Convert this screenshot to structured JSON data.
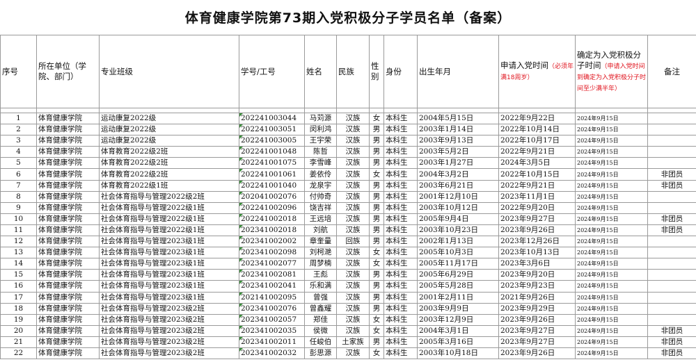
{
  "title": "体育健康学院第73期入党积极分子学员名单（备案）",
  "headers": {
    "seq": "序号",
    "unit": "所在单位（学院、部门）",
    "class": "专业班级",
    "id": "学号/工号",
    "name": "姓名",
    "ethnicity": "民族",
    "gender": "性别",
    "identity": "身份",
    "birth": "出生年月",
    "apply": "申请入党时间",
    "apply_note": "（必须年满18周岁）",
    "confirm": "确定为入党积极分子时间",
    "confirm_note": "（申请入党时间到确定为入党积极分子时间至少满半年）",
    "remark": "备注"
  },
  "rows": [
    {
      "seq": "1",
      "unit": "体育健康学院",
      "class": "运动康复2022级",
      "id": "202241003044",
      "name": "马苅源",
      "ethnicity": "汉族",
      "gender": "女",
      "identity": "本科生",
      "birth": "2004年5月15日",
      "apply": "2022年9月22日",
      "confirm": "2024年9月15日",
      "remark": ""
    },
    {
      "seq": "2",
      "unit": "体育健康学院",
      "class": "运动康复2022级",
      "id": "202241003051",
      "name": "闵利鸿",
      "ethnicity": "汉族",
      "gender": "男",
      "identity": "本科生",
      "birth": "2003年1月14日",
      "apply": "2022年10月14日",
      "confirm": "2024年9月15日",
      "remark": ""
    },
    {
      "seq": "3",
      "unit": "体育健康学院",
      "class": "运动康复2022级",
      "id": "202241003005",
      "name": "王宇荣",
      "ethnicity": "汉族",
      "gender": "男",
      "identity": "本科生",
      "birth": "2003年9月13日",
      "apply": "2022年10月17日",
      "confirm": "2024年9月15日",
      "remark": ""
    },
    {
      "seq": "4",
      "unit": "体育健康学院",
      "class": "体育教育2022级2班",
      "id": "202241001048",
      "name": "陈哲",
      "ethnicity": "汉族",
      "gender": "男",
      "identity": "本科生",
      "birth": "2003年5月2日",
      "apply": "2022年9月21日",
      "confirm": "2024年9月15日",
      "remark": ""
    },
    {
      "seq": "5",
      "unit": "体育健康学院",
      "class": "体育教育2022级2班",
      "id": "202241001075",
      "name": "李雪峰",
      "ethnicity": "汉族",
      "gender": "男",
      "identity": "本科生",
      "birth": "2003年1月27日",
      "apply": "2024年3月5日",
      "confirm": "2024年9月15日",
      "remark": ""
    },
    {
      "seq": "6",
      "unit": "体育健康学院",
      "class": "体育教育2022级2班",
      "id": "202241001061",
      "name": "姜依伶",
      "ethnicity": "汉族",
      "gender": "女",
      "identity": "本科生",
      "birth": "2004年3月2日",
      "apply": "2022年10月15日",
      "confirm": "2024年9月15日",
      "remark": "非团员"
    },
    {
      "seq": "7",
      "unit": "体育健康学院",
      "class": "体育教育2022级1班",
      "id": "202241001040",
      "name": "龙泉宇",
      "ethnicity": "汉族",
      "gender": "男",
      "identity": "本科生",
      "birth": "2003年6月21日",
      "apply": "2022年9月21日",
      "confirm": "2024年9月15日",
      "remark": "非团员"
    },
    {
      "seq": "8",
      "unit": "体育健康学院",
      "class": "社会体育指导与管理2022级2班",
      "id": "202041002076",
      "name": "付帅奇",
      "ethnicity": "汉族",
      "gender": "男",
      "identity": "本科生",
      "birth": "2001年12月10日",
      "apply": "2023年11月1日",
      "confirm": "2024年9月15日",
      "remark": ""
    },
    {
      "seq": "9",
      "unit": "体育健康学院",
      "class": "社会体育指导与管理2022级1班",
      "id": "202241002096",
      "name": "饶吉祥",
      "ethnicity": "汉族",
      "gender": "男",
      "identity": "本科生",
      "birth": "2003年10月12日",
      "apply": "2022年9月20日",
      "confirm": "2024年9月15日",
      "remark": ""
    },
    {
      "seq": "10",
      "unit": "体育健康学院",
      "class": "社会体育指导与管理2022级1班",
      "id": "202241002018",
      "name": "王远培",
      "ethnicity": "汉族",
      "gender": "男",
      "identity": "本科生",
      "birth": "2005年9月4日",
      "apply": "2023年9月27日",
      "confirm": "2024年9月15日",
      "remark": "非团员"
    },
    {
      "seq": "11",
      "unit": "体育健康学院",
      "class": "社会体育指导与管理2022级1班",
      "id": "202341002018",
      "name": "刘航",
      "ethnicity": "汉族",
      "gender": "男",
      "identity": "本科生",
      "birth": "2003年10月23日",
      "apply": "2023年9月26日",
      "confirm": "2024年9月15日",
      "remark": "非团员"
    },
    {
      "seq": "12",
      "unit": "体育健康学院",
      "class": "社会体育指导与管理2023级1班",
      "id": "202341002002",
      "name": "章奎量",
      "ethnicity": "回族",
      "gender": "男",
      "identity": "本科生",
      "birth": "2002年1月13日",
      "apply": "2023年12月26日",
      "confirm": "2024年9月15日",
      "remark": ""
    },
    {
      "seq": "13",
      "unit": "体育健康学院",
      "class": "社会体育指导与管理2023级1班",
      "id": "202341002098",
      "name": "刘柯滟",
      "ethnicity": "汉族",
      "gender": "女",
      "identity": "本科生",
      "birth": "2005年10月3日",
      "apply": "2023年10月13日",
      "confirm": "2024年9月15日",
      "remark": ""
    },
    {
      "seq": "14",
      "unit": "体育健康学院",
      "class": "社会体育指导与管理2023级1班",
      "id": "202341002077",
      "name": "周梦楠",
      "ethnicity": "汉族",
      "gender": "女",
      "identity": "本科生",
      "birth": "2005年11月17日",
      "apply": "2023年3月6日",
      "confirm": "2024年9月15日",
      "remark": ""
    },
    {
      "seq": "15",
      "unit": "体育健康学院",
      "class": "社会体育指导与管理2023级1班",
      "id": "202341002081",
      "name": "王彪",
      "ethnicity": "汉族",
      "gender": "男",
      "identity": "本科生",
      "birth": "2005年6月29日",
      "apply": "2023年9月20日",
      "confirm": "2024年9月15日",
      "remark": ""
    },
    {
      "seq": "16",
      "unit": "体育健康学院",
      "class": "社会体育指导与管理2023级1班",
      "id": "202341002041",
      "name": "乐和满",
      "ethnicity": "汉族",
      "gender": "男",
      "identity": "本科生",
      "birth": "2005年5月28日",
      "apply": "2023年9月23日",
      "confirm": "2024年9月15日",
      "remark": ""
    },
    {
      "seq": "17",
      "unit": "体育健康学院",
      "class": "社会体育指导与管理2023级1班",
      "id": "202141002095",
      "name": "曾强",
      "ethnicity": "汉族",
      "gender": "男",
      "identity": "本科生",
      "birth": "2001年2月11日",
      "apply": "2021年9月26日",
      "confirm": "2024年9月15日",
      "remark": ""
    },
    {
      "seq": "18",
      "unit": "体育健康学院",
      "class": "社会体育指导与管理2023级2班",
      "id": "202341002076",
      "name": "曾鑫耀",
      "ethnicity": "汉族",
      "gender": "男",
      "identity": "本科生",
      "birth": "2003年9月9日",
      "apply": "2023年9月29日",
      "confirm": "2024年9月15日",
      "remark": ""
    },
    {
      "seq": "19",
      "unit": "体育健康学院",
      "class": "社会体育指导与管理2023级2班",
      "id": "202341002057",
      "name": "郑佳",
      "ethnicity": "汉族",
      "gender": "女",
      "identity": "本科生",
      "birth": "2003年12月9日",
      "apply": "2023年9月26日",
      "confirm": "2024年9月15日",
      "remark": ""
    },
    {
      "seq": "20",
      "unit": "体育健康学院",
      "class": "社会体育指导与管理2023级2班",
      "id": "202341002035",
      "name": "侯微",
      "ethnicity": "汉族",
      "gender": "女",
      "identity": "本科生",
      "birth": "2004年3月1日",
      "apply": "2023年9月27日",
      "confirm": "2024年9月15日",
      "remark": "非团员"
    },
    {
      "seq": "21",
      "unit": "体育健康学院",
      "class": "社会体育指导与管理2023级2班",
      "id": "202341002011",
      "name": "任峻伯",
      "ethnicity": "土家族",
      "gender": "男",
      "identity": "本科生",
      "birth": "2005年3月16日",
      "apply": "2023年9月27日",
      "confirm": "2024年9月15日",
      "remark": "非团员"
    },
    {
      "seq": "22",
      "unit": "体育健康学院",
      "class": "社会体育指导与管理2023级2班",
      "id": "202341002032",
      "name": "彭思源",
      "ethnicity": "汉族",
      "gender": "女",
      "identity": "本科生",
      "birth": "2003年10月18日",
      "apply": "2023年9月26日",
      "confirm": "2024年9月15日",
      "remark": "非团员"
    }
  ]
}
